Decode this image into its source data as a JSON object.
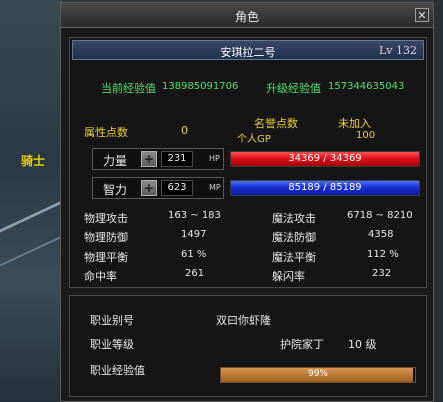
{
  "background": {
    "side_label": "骑士"
  },
  "window": {
    "title": "角色",
    "close_label": "✕"
  },
  "character": {
    "name": "安琪拉二号",
    "level": "Lv 132"
  },
  "experience": {
    "current_label": "当前经验值",
    "current_value": "138985091706",
    "next_label": "升级经验值",
    "next_value": "157344635043"
  },
  "points": {
    "attr_label": "属性点数",
    "attr_value": "0",
    "fame_label": "名誉点数",
    "fame_value": "未加入",
    "gp_label": "个人GP",
    "gp_value": "100"
  },
  "stats": {
    "str_label": "力量",
    "str_value": "231",
    "hp_unit": "HP",
    "int_label": "智力",
    "int_value": "623",
    "mp_unit": "MP"
  },
  "hp": {
    "current": 34369,
    "max": 34369,
    "text": "34369 / 34369",
    "color": "#e01018"
  },
  "mp": {
    "current": 85189,
    "max": 85189,
    "text": "85189 / 85189",
    "color": "#1830d0"
  },
  "combat": {
    "left": [
      {
        "label": "物理攻击",
        "value": "163 ~ 183"
      },
      {
        "label": "物理防御",
        "value": "1497"
      },
      {
        "label": "物理平衡",
        "value": "61 %"
      },
      {
        "label": "命中率",
        "value": "261"
      }
    ],
    "right": [
      {
        "label": "魔法攻击",
        "value": "6718 ~ 8210"
      },
      {
        "label": "魔法防御",
        "value": "4358"
      },
      {
        "label": "魔法平衡",
        "value": "112 %"
      },
      {
        "label": "躲闪率",
        "value": "232"
      }
    ]
  },
  "job": {
    "alias_label": "职业别号",
    "alias_value": "双曰你虾隆",
    "level_label": "职业等级",
    "title_value": "护院家丁",
    "level_value": "10 级",
    "exp_label": "职业经验值",
    "exp_percent": 99,
    "exp_text": "99%"
  }
}
